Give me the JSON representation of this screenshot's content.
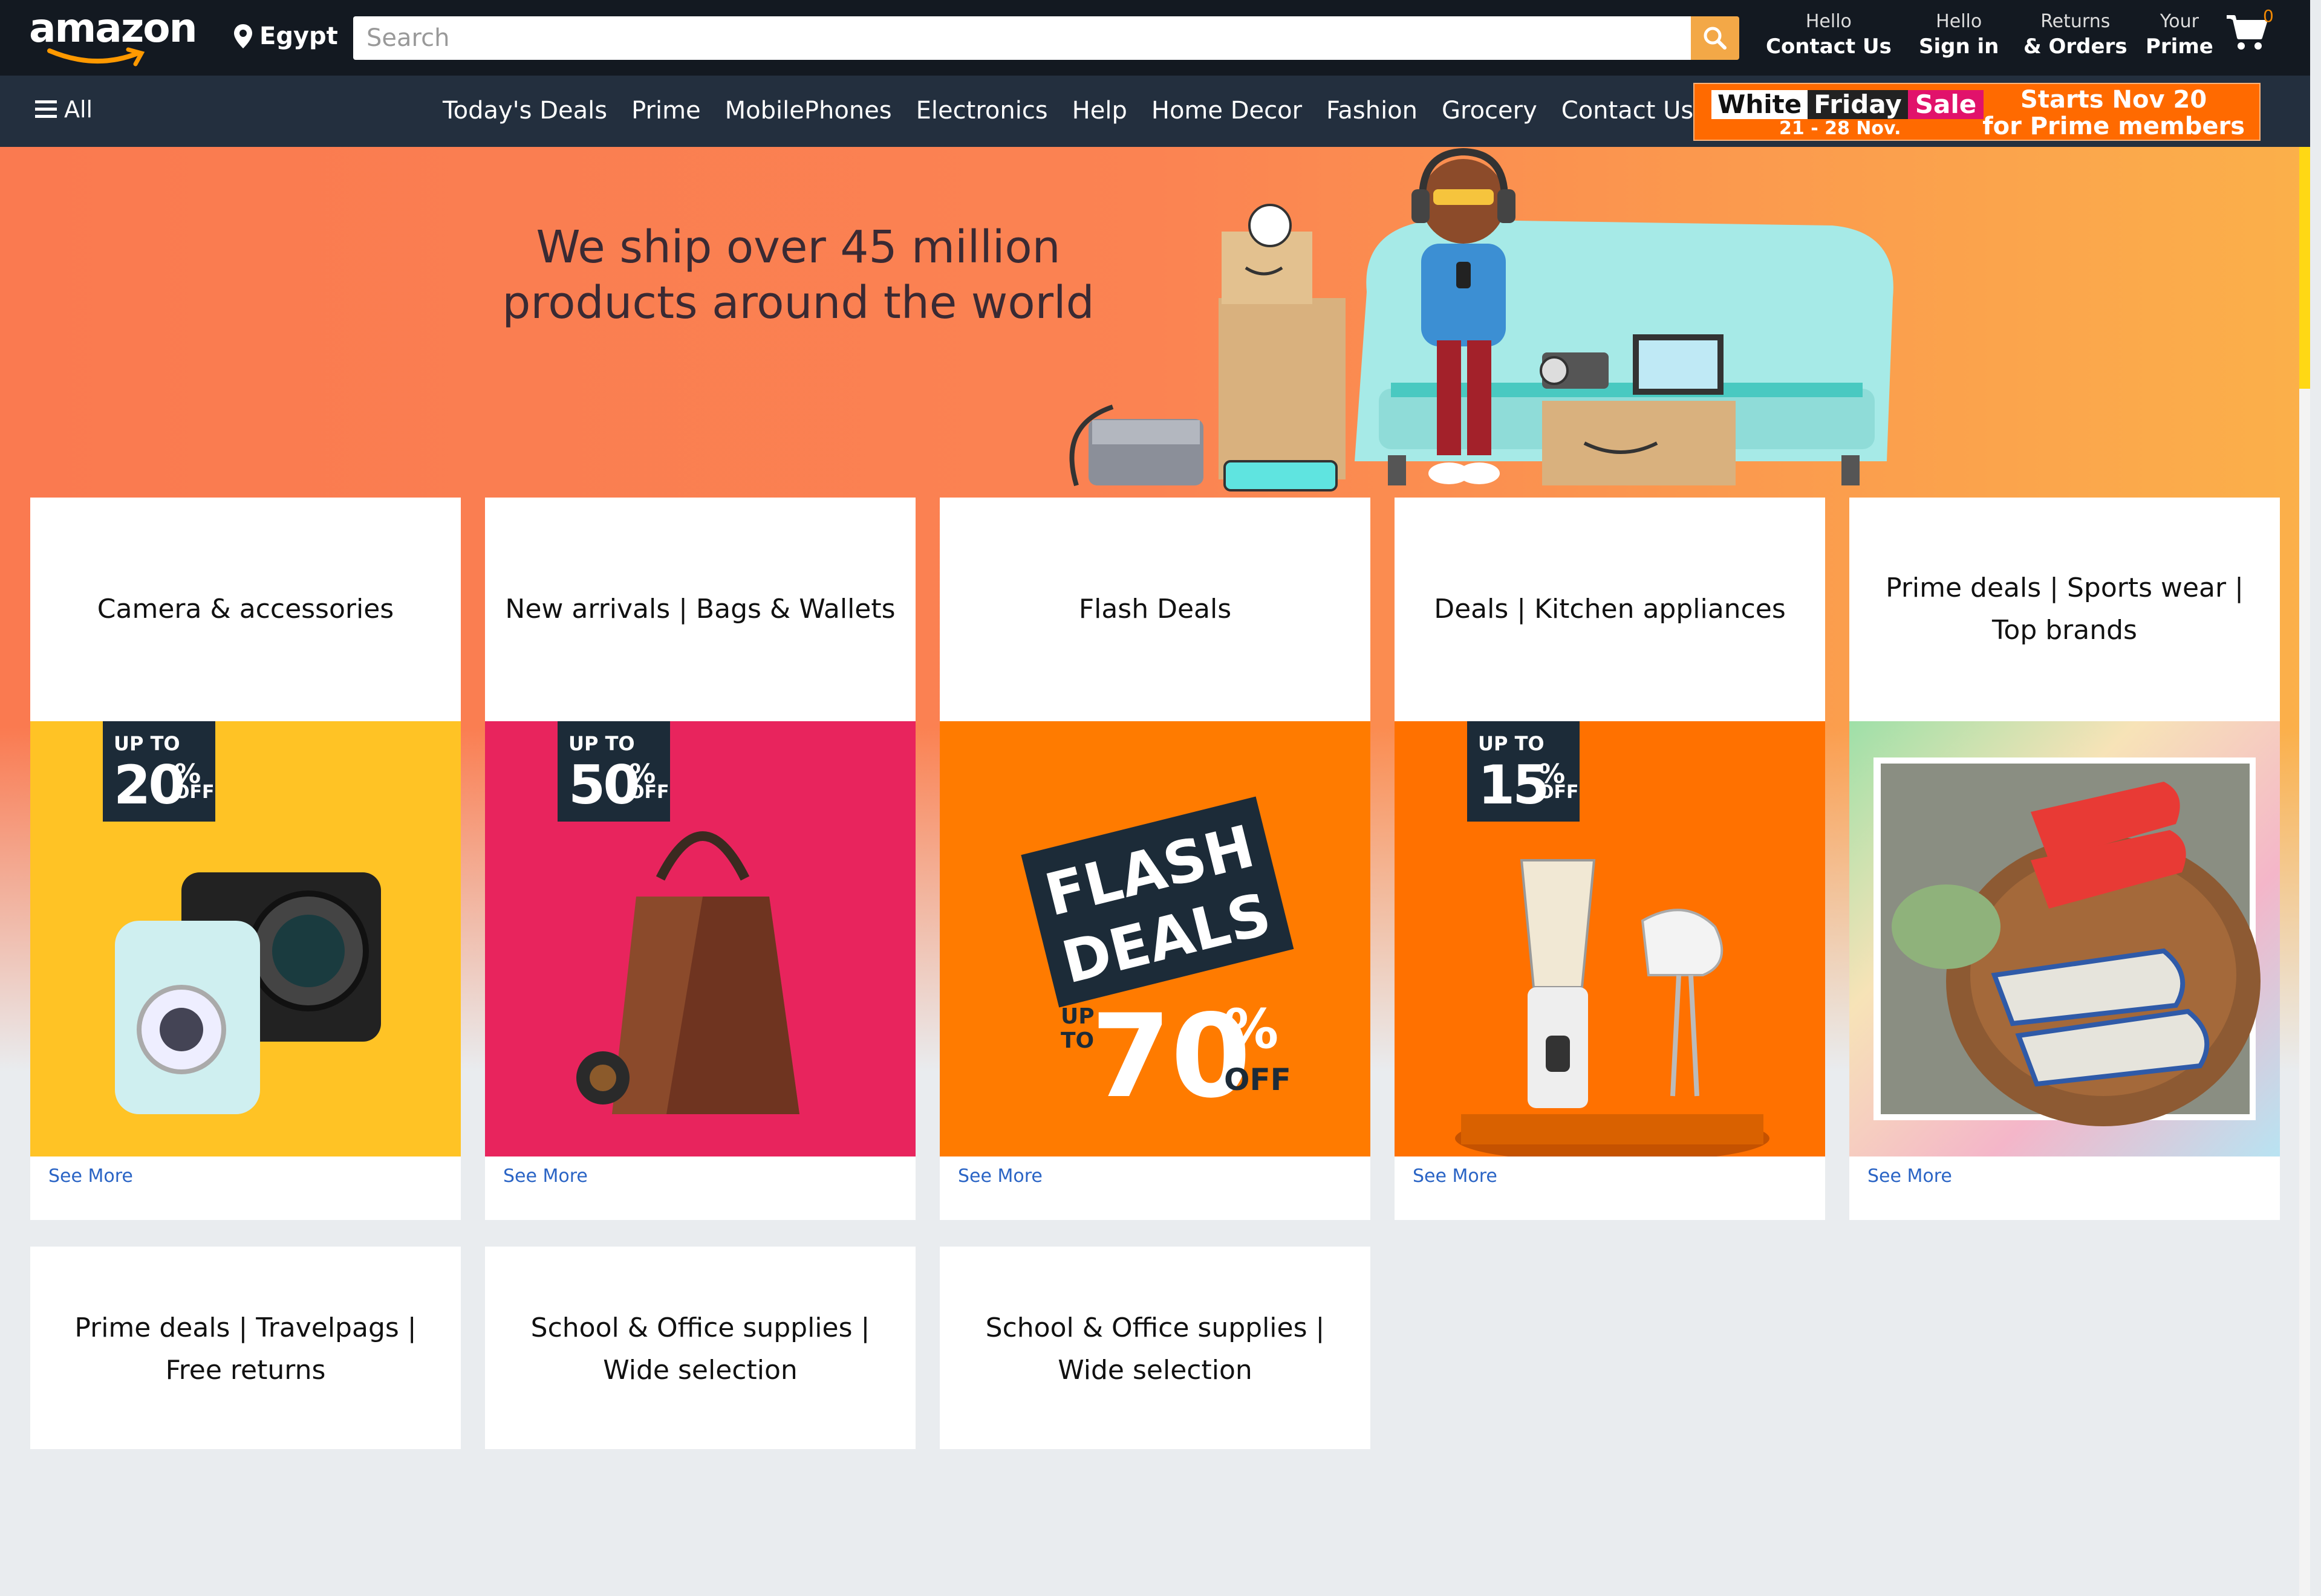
{
  "header": {
    "logo": "amazon",
    "location": "Egypt",
    "search_placeholder": "Search",
    "links": [
      {
        "line1": "Hello",
        "line2": "Contact Us"
      },
      {
        "line1": "Hello",
        "line2": "Sign in"
      },
      {
        "line1": "Returns",
        "line2": "& Orders"
      },
      {
        "line1": "Your",
        "line2": "Prime"
      }
    ],
    "cart_count": "0"
  },
  "subnav": {
    "all_label": "All",
    "items": [
      "Today's Deals",
      "Prime",
      "MobilePhones",
      "Electronics",
      "Help",
      "Home Decor",
      "Fashion",
      "Grocery",
      "Contact Us"
    ],
    "promo": {
      "word1": "White",
      "word2": "Friday",
      "word3": "Sale",
      "dates": "21 - 28 Nov.",
      "starts_line1": "Starts Nov 20",
      "starts_line2": "for Prime members"
    }
  },
  "hero": {
    "headline_line1": "We ship over 45 million",
    "headline_line2": "products around the world"
  },
  "cards": [
    {
      "title": "Camera & accessories",
      "badge_upto": "UP TO",
      "badge_pct": "20",
      "badge_off": "OFF",
      "see_more": "See More"
    },
    {
      "title": "New arrivals | Bags & Wallets",
      "badge_upto": "UP TO",
      "badge_pct": "50",
      "badge_off": "OFF",
      "see_more": "See More"
    },
    {
      "title": "Flash Deals",
      "flash_line1": "FLASH",
      "flash_line2": "DEALS",
      "flash_upto_1": "UP",
      "flash_upto_2": "TO",
      "flash_pct": "70",
      "flash_off": "OFF",
      "see_more": "See More"
    },
    {
      "title": "Deals | Kitchen appliances",
      "badge_upto": "UP TO",
      "badge_pct": "15",
      "badge_off": "OFF",
      "see_more": "See More"
    },
    {
      "title": "Prime deals | Sports wear | Top brands",
      "see_more": "See More"
    }
  ],
  "cards_row2": [
    {
      "title": "Prime deals | Travelpags | Free returns"
    },
    {
      "title": "School & Office supplies | Wide selection"
    },
    {
      "title": "School & Office supplies | Wide selection"
    }
  ],
  "colors": {
    "topbar": "#131921",
    "subnav": "#232f3e",
    "search_button": "#f3a847",
    "link_blue": "#2a64c5"
  }
}
